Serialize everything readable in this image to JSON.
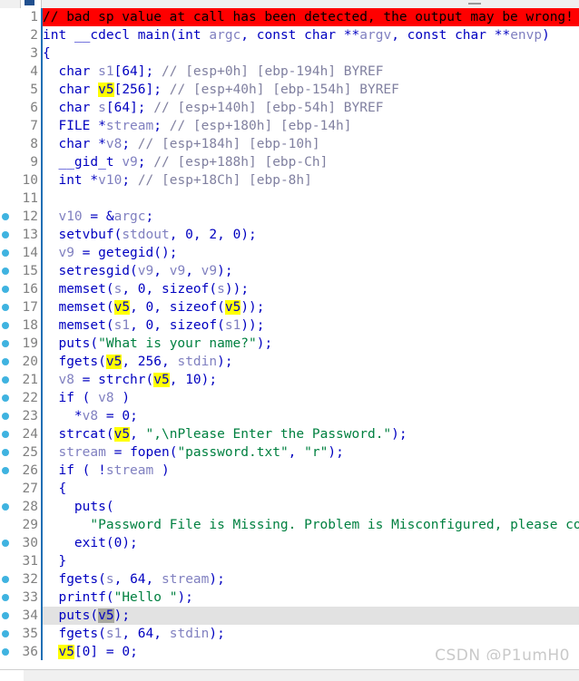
{
  "app": {
    "name": "IDA Pro Pseudocode View",
    "view_type": "decompiler-pseudocode"
  },
  "tabstrip": {
    "active_tab_icon": "document-icon",
    "tab_labels": [
      "",
      ""
    ]
  },
  "editor": {
    "warning_banner": {
      "text": "// bad sp value at call has been detected, the output may be wrong!",
      "bg_color": "#ff0000",
      "text_color": "#000000",
      "line_number": 1
    },
    "colors": {
      "keyword": "#0000c0",
      "string": "#008040",
      "comment": "#8080a0",
      "variable": "#8080c0",
      "highlight": "#ffff00",
      "selected_line": "#e2e2e2",
      "breakpoint_dot": "#3fb3e0",
      "gutter_rule": "#1f6fb4",
      "line_number": "#808080"
    },
    "highlighted_symbol": "v5",
    "selected_line": 34,
    "lines": [
      {
        "n": 1,
        "bp": false,
        "warn": true,
        "text": "// bad sp value at call has been detected, the output may be wrong!"
      },
      {
        "n": 2,
        "bp": false,
        "text": "int __cdecl main(int argc, const char **argv, const char **envp)"
      },
      {
        "n": 3,
        "bp": false,
        "text": "{"
      },
      {
        "n": 4,
        "bp": false,
        "text": "  char s1[64]; // [esp+0h] [ebp-194h] BYREF"
      },
      {
        "n": 5,
        "bp": false,
        "text": "  char v5[256]; // [esp+40h] [ebp-154h] BYREF"
      },
      {
        "n": 6,
        "bp": false,
        "text": "  char s[64]; // [esp+140h] [ebp-54h] BYREF"
      },
      {
        "n": 7,
        "bp": false,
        "text": "  FILE *stream; // [esp+180h] [ebp-14h]"
      },
      {
        "n": 8,
        "bp": false,
        "text": "  char *v8; // [esp+184h] [ebp-10h]"
      },
      {
        "n": 9,
        "bp": false,
        "text": "  __gid_t v9; // [esp+188h] [ebp-Ch]"
      },
      {
        "n": 10,
        "bp": false,
        "text": "  int *v10; // [esp+18Ch] [ebp-8h]"
      },
      {
        "n": 11,
        "bp": false,
        "text": ""
      },
      {
        "n": 12,
        "bp": true,
        "text": "  v10 = &argc;"
      },
      {
        "n": 13,
        "bp": true,
        "text": "  setvbuf(stdout, 0, 2, 0);"
      },
      {
        "n": 14,
        "bp": true,
        "text": "  v9 = getegid();"
      },
      {
        "n": 15,
        "bp": true,
        "text": "  setresgid(v9, v9, v9);"
      },
      {
        "n": 16,
        "bp": true,
        "text": "  memset(s, 0, sizeof(s));"
      },
      {
        "n": 17,
        "bp": true,
        "text": "  memset(v5, 0, sizeof(v5));"
      },
      {
        "n": 18,
        "bp": true,
        "text": "  memset(s1, 0, sizeof(s1));"
      },
      {
        "n": 19,
        "bp": true,
        "text": "  puts(\"What is your name?\");"
      },
      {
        "n": 20,
        "bp": true,
        "text": "  fgets(v5, 256, stdin);"
      },
      {
        "n": 21,
        "bp": true,
        "text": "  v8 = strchr(v5, 10);"
      },
      {
        "n": 22,
        "bp": true,
        "text": "  if ( v8 )"
      },
      {
        "n": 23,
        "bp": true,
        "text": "    *v8 = 0;"
      },
      {
        "n": 24,
        "bp": true,
        "text": "  strcat(v5, \",\\nPlease Enter the Password.\");"
      },
      {
        "n": 25,
        "bp": true,
        "text": "  stream = fopen(\"password.txt\", \"r\");"
      },
      {
        "n": 26,
        "bp": true,
        "text": "  if ( !stream )"
      },
      {
        "n": 27,
        "bp": false,
        "text": "  {"
      },
      {
        "n": 28,
        "bp": true,
        "text": "    puts("
      },
      {
        "n": 29,
        "bp": false,
        "text": "      \"Password File is Missing. Problem is Misconfigured, please co"
      },
      {
        "n": 30,
        "bp": true,
        "text": "    exit(0);"
      },
      {
        "n": 31,
        "bp": false,
        "text": "  }"
      },
      {
        "n": 32,
        "bp": true,
        "text": "  fgets(s, 64, stream);"
      },
      {
        "n": 33,
        "bp": true,
        "text": "  printf(\"Hello \");"
      },
      {
        "n": 34,
        "bp": true,
        "text": "  puts(v5);",
        "selected": true
      },
      {
        "n": 35,
        "bp": true,
        "text": "  fgets(s1, 64, stdin);"
      },
      {
        "n": 36,
        "bp": true,
        "text": "  v5[0] = 0;"
      }
    ]
  },
  "watermark": {
    "text": "CSDN @P1umH0"
  },
  "statusbar": {
    "cells": [
      "",
      "",
      "",
      ""
    ]
  }
}
